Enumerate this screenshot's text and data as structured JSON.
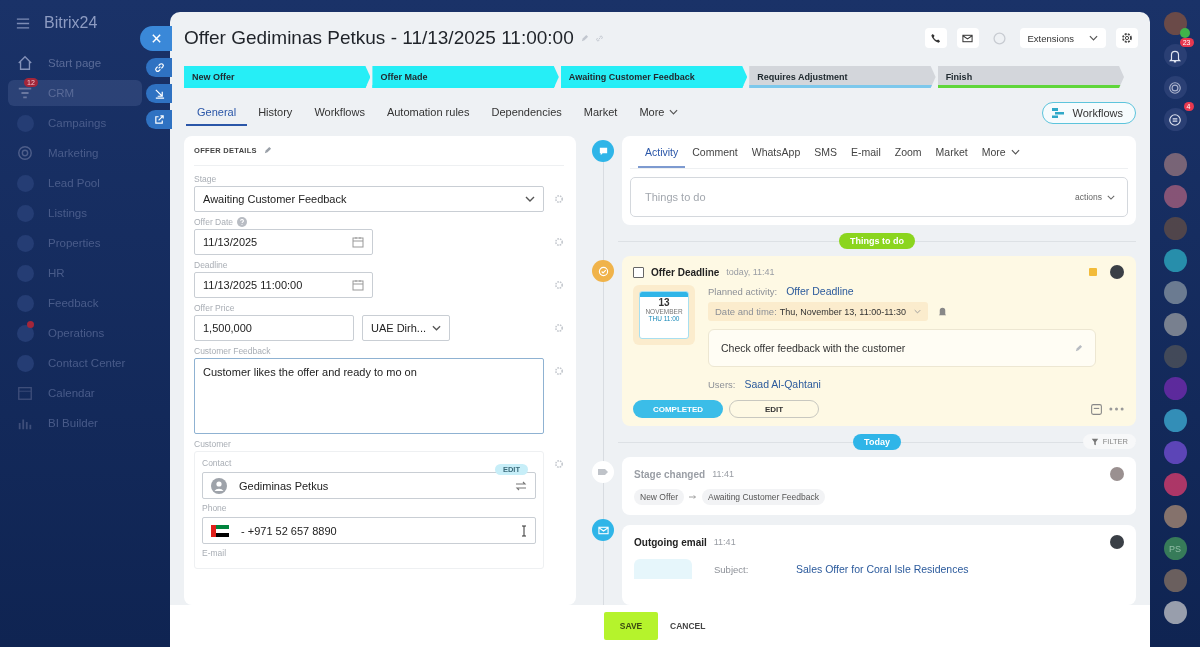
{
  "sidebar": {
    "logo": "Bitrix24",
    "items": [
      {
        "label": "Start page",
        "selected": false,
        "dot": false
      },
      {
        "label": "CRM",
        "selected": true,
        "dot": false,
        "badge": "12"
      },
      {
        "label": "Campaings",
        "selected": false,
        "dot": false
      },
      {
        "label": "Marketing",
        "selected": false,
        "dot": false
      },
      {
        "label": "Lead Pool",
        "selected": false,
        "dot": false
      },
      {
        "label": "Listings",
        "selected": false,
        "dot": false
      },
      {
        "label": "Properties",
        "selected": false,
        "dot": false
      },
      {
        "label": "HR",
        "selected": false,
        "dot": false
      },
      {
        "label": "Feedback",
        "selected": false,
        "dot": false
      },
      {
        "label": "Operations",
        "selected": false,
        "dot": true
      },
      {
        "label": "Contact Center",
        "selected": false,
        "dot": false
      },
      {
        "label": "Calendar",
        "selected": false,
        "dot": false
      },
      {
        "label": "BI Builder",
        "selected": false,
        "dot": false
      }
    ]
  },
  "slider_buttons": [
    {
      "kind": "close"
    },
    {
      "kind": "link"
    },
    {
      "kind": "minimize"
    },
    {
      "kind": "open"
    }
  ],
  "header": {
    "title": "Offer Gediminas Petkus - 11/13/2025 11:00:00",
    "extensions": "Extensions"
  },
  "stages": [
    {
      "label": "New Offer",
      "reached": true,
      "color": "#22eef6"
    },
    {
      "label": "Offer Made",
      "reached": true,
      "color": "#22eef6"
    },
    {
      "label": "Awaiting Customer Feedback",
      "reached": true,
      "color": "#22eef6"
    },
    {
      "label": "Requires Adjustment",
      "reached": false,
      "color": "#7cc8ec"
    },
    {
      "label": "Finish",
      "reached": false,
      "color": "#5fd63a"
    }
  ],
  "tabs": [
    {
      "label": "General",
      "selected": true
    },
    {
      "label": "History",
      "selected": false
    },
    {
      "label": "Workflows",
      "selected": false
    },
    {
      "label": "Automation rules",
      "selected": false
    },
    {
      "label": "Dependencies",
      "selected": false
    },
    {
      "label": "Market",
      "selected": false
    },
    {
      "label": "More",
      "selected": false,
      "menu": true
    }
  ],
  "workflows_button": "Workflows",
  "details": {
    "title": "OFFER DETAILS",
    "fields": [
      {
        "kind": "select",
        "label": "Stage",
        "value": "Awaiting Customer Feedback"
      },
      {
        "kind": "date",
        "label": "Offer Date",
        "value": "11/13/2025",
        "help": true
      },
      {
        "kind": "date",
        "label": "Deadline",
        "value": "11/13/2025 11:00:00"
      },
      {
        "kind": "money",
        "label": "Offer Price",
        "value": "1,500,000",
        "currency": "UAE Dirh..."
      },
      {
        "kind": "textarea",
        "label": "Customer Feedback",
        "value": "Customer likes the offer and ready to mo on"
      },
      {
        "kind": "client",
        "label": "Customer",
        "contact_label": "Contact",
        "contact": "Gediminas Petkus",
        "edit": "EDIT",
        "phone_label": "Phone",
        "phone": "- +971 52 657 8890",
        "email_label": "E-mail"
      }
    ]
  },
  "composer": {
    "tabs": [
      {
        "label": "Activity",
        "selected": true
      },
      {
        "label": "Comment",
        "selected": false
      },
      {
        "label": "WhatsApp",
        "selected": false
      },
      {
        "label": "SMS",
        "selected": false
      },
      {
        "label": "E-mail",
        "selected": false
      },
      {
        "label": "Zoom",
        "selected": false
      },
      {
        "label": "Market",
        "selected": false
      },
      {
        "label": "More",
        "selected": false,
        "menu": true
      }
    ],
    "placeholder": "Things to do",
    "actions": "actions"
  },
  "todo_divider": "Things to do",
  "deadline_card": {
    "title": "Offer Deadline",
    "time": "today, 11:41",
    "checked": false,
    "day": "13",
    "month": "NOVEMBER",
    "weekday_time": "THU 11:00",
    "planned_label": "Planned activity:",
    "planned": "Offer Deadline",
    "date_label": "Date and time:",
    "date": "Thu, November 13, 11:00-11:30",
    "note": "Check offer feedback with the customer",
    "users_label": "Users:",
    "user": "Saad Al-Qahtani",
    "completed": "COMPLETED",
    "edit": "EDIT"
  },
  "today_divider": "Today",
  "filter": "FILTER",
  "stage_card": {
    "title": "Stage changed",
    "time": "11:41",
    "from": "New Offer",
    "to": "Awaiting Customer Feedback"
  },
  "email_card": {
    "title": "Outgoing email",
    "time": "11:41",
    "subject_label": "Subject:",
    "subject": "Sales Offer for Coral Isle Residences"
  },
  "footer": {
    "save": "SAVE",
    "cancel": "CANCEL"
  },
  "right_rail": {
    "notifications": "23",
    "chats": "4",
    "initials": "PS"
  }
}
